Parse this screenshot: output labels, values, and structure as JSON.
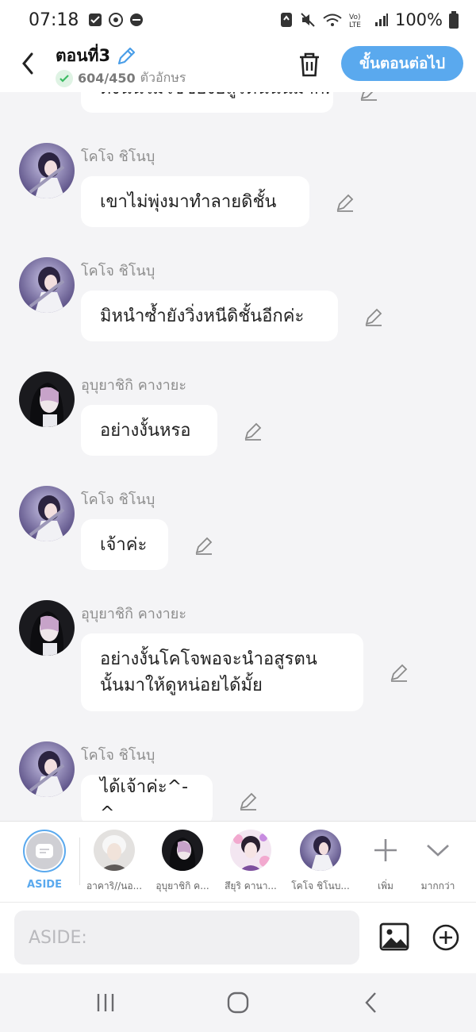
{
  "status_bar": {
    "time": "07:18",
    "battery": "100%"
  },
  "header": {
    "title": "ตอนที่3",
    "char_count": "604/450",
    "char_unit": "ตัวอักษร",
    "next_label": "ขั้นตอนต่อไป"
  },
  "messages": [
    {
      "name": "",
      "text": "ดังนั้นไม่ใช่ช่องอสูรตนนั้นมากค่ะ"
    },
    {
      "name": "โคโจ ชิโนบุ",
      "text": "เขาไม่พุ่งมาทำลายดิชั้น"
    },
    {
      "name": "โคโจ ชิโนบุ",
      "text": "มิหนำซ้ำยังวิ่งหนีดิชั้นอีกค่ะ"
    },
    {
      "name": "อุบุยาชิกิ คางายะ",
      "text": "อย่างงั้นหรอ"
    },
    {
      "name": "โคโจ ชิโนบุ",
      "text": "เจ้าค่ะ"
    },
    {
      "name": "อุบุยาชิกิ คางายะ",
      "text_line1": "อย่างงั้นโคโจพอจะนำอสูรตน",
      "text_line2": "นั้นมาให้ดูหน่อยได้มั้ย"
    },
    {
      "name": "โคโจ ชิโนบุ",
      "text": "ได้เจ้าค่ะ^-^"
    }
  ],
  "characters": {
    "aside": "ASIDE",
    "items": [
      {
        "name": "อาคาริ//นอ..."
      },
      {
        "name": "อุบุยาชิกิ ค..."
      },
      {
        "name": "สึยุริ คานา..."
      },
      {
        "name": "โคโจ ชิโนบ..."
      }
    ],
    "add_label": "เพิ่ม",
    "more_label": "มากกว่า"
  },
  "input": {
    "placeholder": "ASIDE:"
  },
  "colors": {
    "accent": "#5aa9ee",
    "check": "#3dbb63",
    "background": "#f4f4f6"
  }
}
